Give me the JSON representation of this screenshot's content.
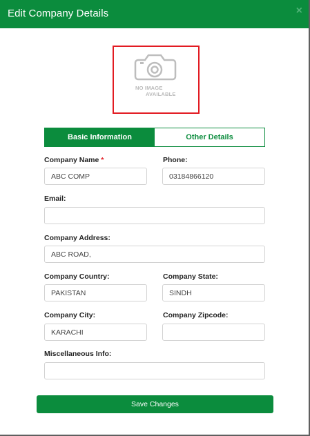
{
  "modal": {
    "title": "Edit Company Details",
    "close_symbol": "×"
  },
  "photo": {
    "icon": "camera-icon",
    "text_line1": "NO IMAGE",
    "text_line2": "AVAILABLE",
    "border_color": "#e21b22"
  },
  "tabs": [
    {
      "label": "Basic Information",
      "active": true
    },
    {
      "label": "Other Details",
      "active": false
    }
  ],
  "form": {
    "company_name": {
      "label": "Company Name",
      "required_mark": "*",
      "value": "ABC COMP"
    },
    "phone": {
      "label": "Phone:",
      "value": "03184866120"
    },
    "email": {
      "label": "Email:",
      "value": ""
    },
    "company_address": {
      "label": "Company Address:",
      "value": "ABC ROAD,"
    },
    "company_country": {
      "label": "Company Country:",
      "value": "PAKISTAN"
    },
    "company_state": {
      "label": "Company State:",
      "value": "SINDH"
    },
    "company_city": {
      "label": "Company City:",
      "value": "KARACHI"
    },
    "company_zipcode": {
      "label": "Company Zipcode:",
      "value": ""
    },
    "misc_info": {
      "label": "Miscellaneous Info:",
      "value": ""
    }
  },
  "actions": {
    "save_label": "Save Changes"
  },
  "colors": {
    "brand_green": "#0b8c3d",
    "required_red": "#e21b22"
  }
}
